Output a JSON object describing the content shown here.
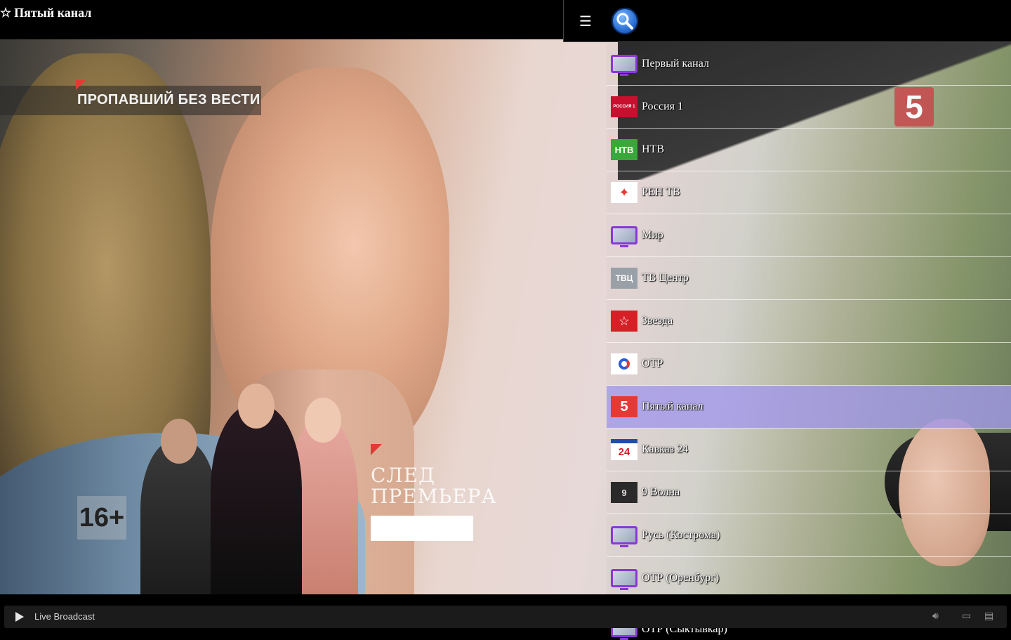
{
  "header": {
    "favorite_icon": "star-outline-icon",
    "title": "Пятый канал"
  },
  "menu": {
    "menu_icon": "hamburger-icon",
    "search_icon": "search-icon"
  },
  "video": {
    "promo_text": "ПРОПАВШИЙ БЕЗ ВЕСТИ",
    "channel_logo": "5",
    "age_rating": "16+",
    "next_line1": "СЛЕД",
    "next_line2": "ПРЕМЬЕРА"
  },
  "channels": [
    {
      "name": "Первый канал",
      "icon": "tv-icon",
      "active": false
    },
    {
      "name": "Россия 1",
      "icon": "russia1-logo-icon",
      "active": false
    },
    {
      "name": "НТВ",
      "icon": "ntv-logo-icon",
      "active": false
    },
    {
      "name": "РЕН ТВ",
      "icon": "ren-tv-logo-icon",
      "active": false
    },
    {
      "name": "Мир",
      "icon": "tv-icon",
      "active": false
    },
    {
      "name": "ТВ Центр",
      "icon": "tvc-logo-icon",
      "active": false
    },
    {
      "name": "Звезда",
      "icon": "zvezda-logo-icon",
      "active": false
    },
    {
      "name": "ОТР",
      "icon": "otr-logo-icon",
      "active": false
    },
    {
      "name": "Пятый канал",
      "icon": "five-logo-icon",
      "active": true
    },
    {
      "name": "Кавказ 24",
      "icon": "kavkaz24-logo-icon",
      "active": false
    },
    {
      "name": "9 Волна",
      "icon": "volna9-logo-icon",
      "active": false
    },
    {
      "name": "Русь (Кострома)",
      "icon": "tv-icon",
      "active": false
    },
    {
      "name": "ОТР (Оренбург)",
      "icon": "tv-icon",
      "active": false
    },
    {
      "name": "ОТР (Сыктывкар)",
      "icon": "tv-icon",
      "active": false
    }
  ],
  "icon_text": {
    "russia": "РОССИЯ 1",
    "ntv": "НТВ",
    "ren": "✦",
    "tvc": "ТВЦ",
    "zvezda": "☆",
    "five": "5",
    "kavkaz": "24",
    "volna": "9"
  },
  "player": {
    "play_icon": "play-icon",
    "status": "Live Broadcast",
    "volume_icon": "volume-icon",
    "airplay_icon": "airplay-icon",
    "captions_icon": "captions-icon"
  },
  "colors": {
    "active_row": "#a096eb",
    "tv_icon_purple": "#8a38d6",
    "accent_red": "#e53935"
  }
}
